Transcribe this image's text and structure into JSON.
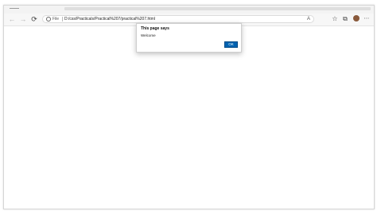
{
  "toolbar": {
    "back_glyph": "←",
    "forward_glyph": "→",
    "reload_glyph": "⟳",
    "address": {
      "scheme_label": "File",
      "url": "D:/css/Practicals/Practical%207/practical%207.html"
    },
    "icons": [
      "info-icon",
      "read-aloud-icon",
      "favorites-star-icon",
      "collections-icon",
      "profile-avatar",
      "more-icon"
    ]
  },
  "dialog": {
    "title": "This page says",
    "message": "Welcome",
    "ok_label": "OK"
  },
  "colors": {
    "accent": "#0063b1",
    "toolbar_bg": "#f7f7f7",
    "tabstrip_bg": "#f3f3f3"
  }
}
